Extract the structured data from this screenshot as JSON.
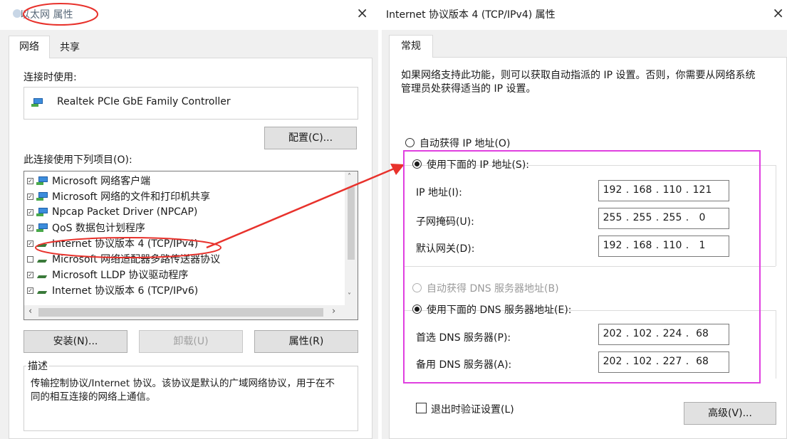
{
  "left": {
    "title": "以太网 属性",
    "close_icon": "×",
    "tabs": [
      "网络",
      "共享"
    ],
    "connect_using_label": "连接时使用:",
    "adapter_name": "Realtek PCIe GbE Family Controller",
    "configure_button": "配置(C)...",
    "items_label": "此连接使用下列项目(O):",
    "items": [
      {
        "label": "Microsoft 网络客户端",
        "checked": true,
        "icon": "network-client-icon"
      },
      {
        "label": "Microsoft 网络的文件和打印机共享",
        "checked": true,
        "icon": "file-share-icon"
      },
      {
        "label": "Npcap Packet Driver (NPCAP)",
        "checked": true,
        "icon": "driver-icon"
      },
      {
        "label": "QoS 数据包计划程序",
        "checked": true,
        "icon": "qos-icon"
      },
      {
        "label": "Internet 协议版本 4 (TCP/IPv4)",
        "checked": true,
        "icon": "protocol-icon"
      },
      {
        "label": "Microsoft 网络适配器多路传送器协议",
        "checked": false,
        "icon": "protocol-icon"
      },
      {
        "label": "Microsoft LLDP 协议驱动程序",
        "checked": true,
        "icon": "protocol-icon"
      },
      {
        "label": "Internet 协议版本 6 (TCP/IPv6)",
        "checked": true,
        "icon": "protocol-icon"
      }
    ],
    "install_button": "安装(N)...",
    "uninstall_button": "卸载(U)",
    "properties_button": "属性(R)",
    "description_label": "描述",
    "description_text": "传输控制协议/Internet 协议。该协议是默认的广域网络协议，用于在不同的相互连接的网络上通信。"
  },
  "right": {
    "title": "Internet 协议版本 4 (TCP/IPv4) 属性",
    "close_icon": "×",
    "tab": "常规",
    "intro": "如果网络支持此功能，则可以获取自动指派的 IP 设置。否则，你需要从网络系统管理员处获得适当的 IP 设置。",
    "auto_ip": "自动获得 IP 地址(O)",
    "manual_ip": "使用下面的 IP 地址(S):",
    "ip_label": "IP 地址(I):",
    "subnet_label": "子网掩码(U):",
    "gateway_label": "默认网关(D):",
    "ip_address": [
      "192",
      "168",
      "110",
      "121"
    ],
    "subnet_mask": [
      "255",
      "255",
      "255",
      "0"
    ],
    "gateway": [
      "192",
      "168",
      "110",
      "1"
    ],
    "auto_dns": "自动获得 DNS 服务器地址(B)",
    "manual_dns": "使用下面的 DNS 服务器地址(E):",
    "preferred_dns_label": "首选 DNS 服务器(P):",
    "alternate_dns_label": "备用 DNS 服务器(A):",
    "preferred_dns": [
      "202",
      "102",
      "224",
      "68"
    ],
    "alternate_dns": [
      "202",
      "102",
      "227",
      "68"
    ],
    "validate_label": "退出时验证设置(L)",
    "validate_checked": false,
    "advanced_button": "高级(V)..."
  },
  "annotations": {
    "color": "#e8322c",
    "highlight_color": "#e040e0"
  }
}
